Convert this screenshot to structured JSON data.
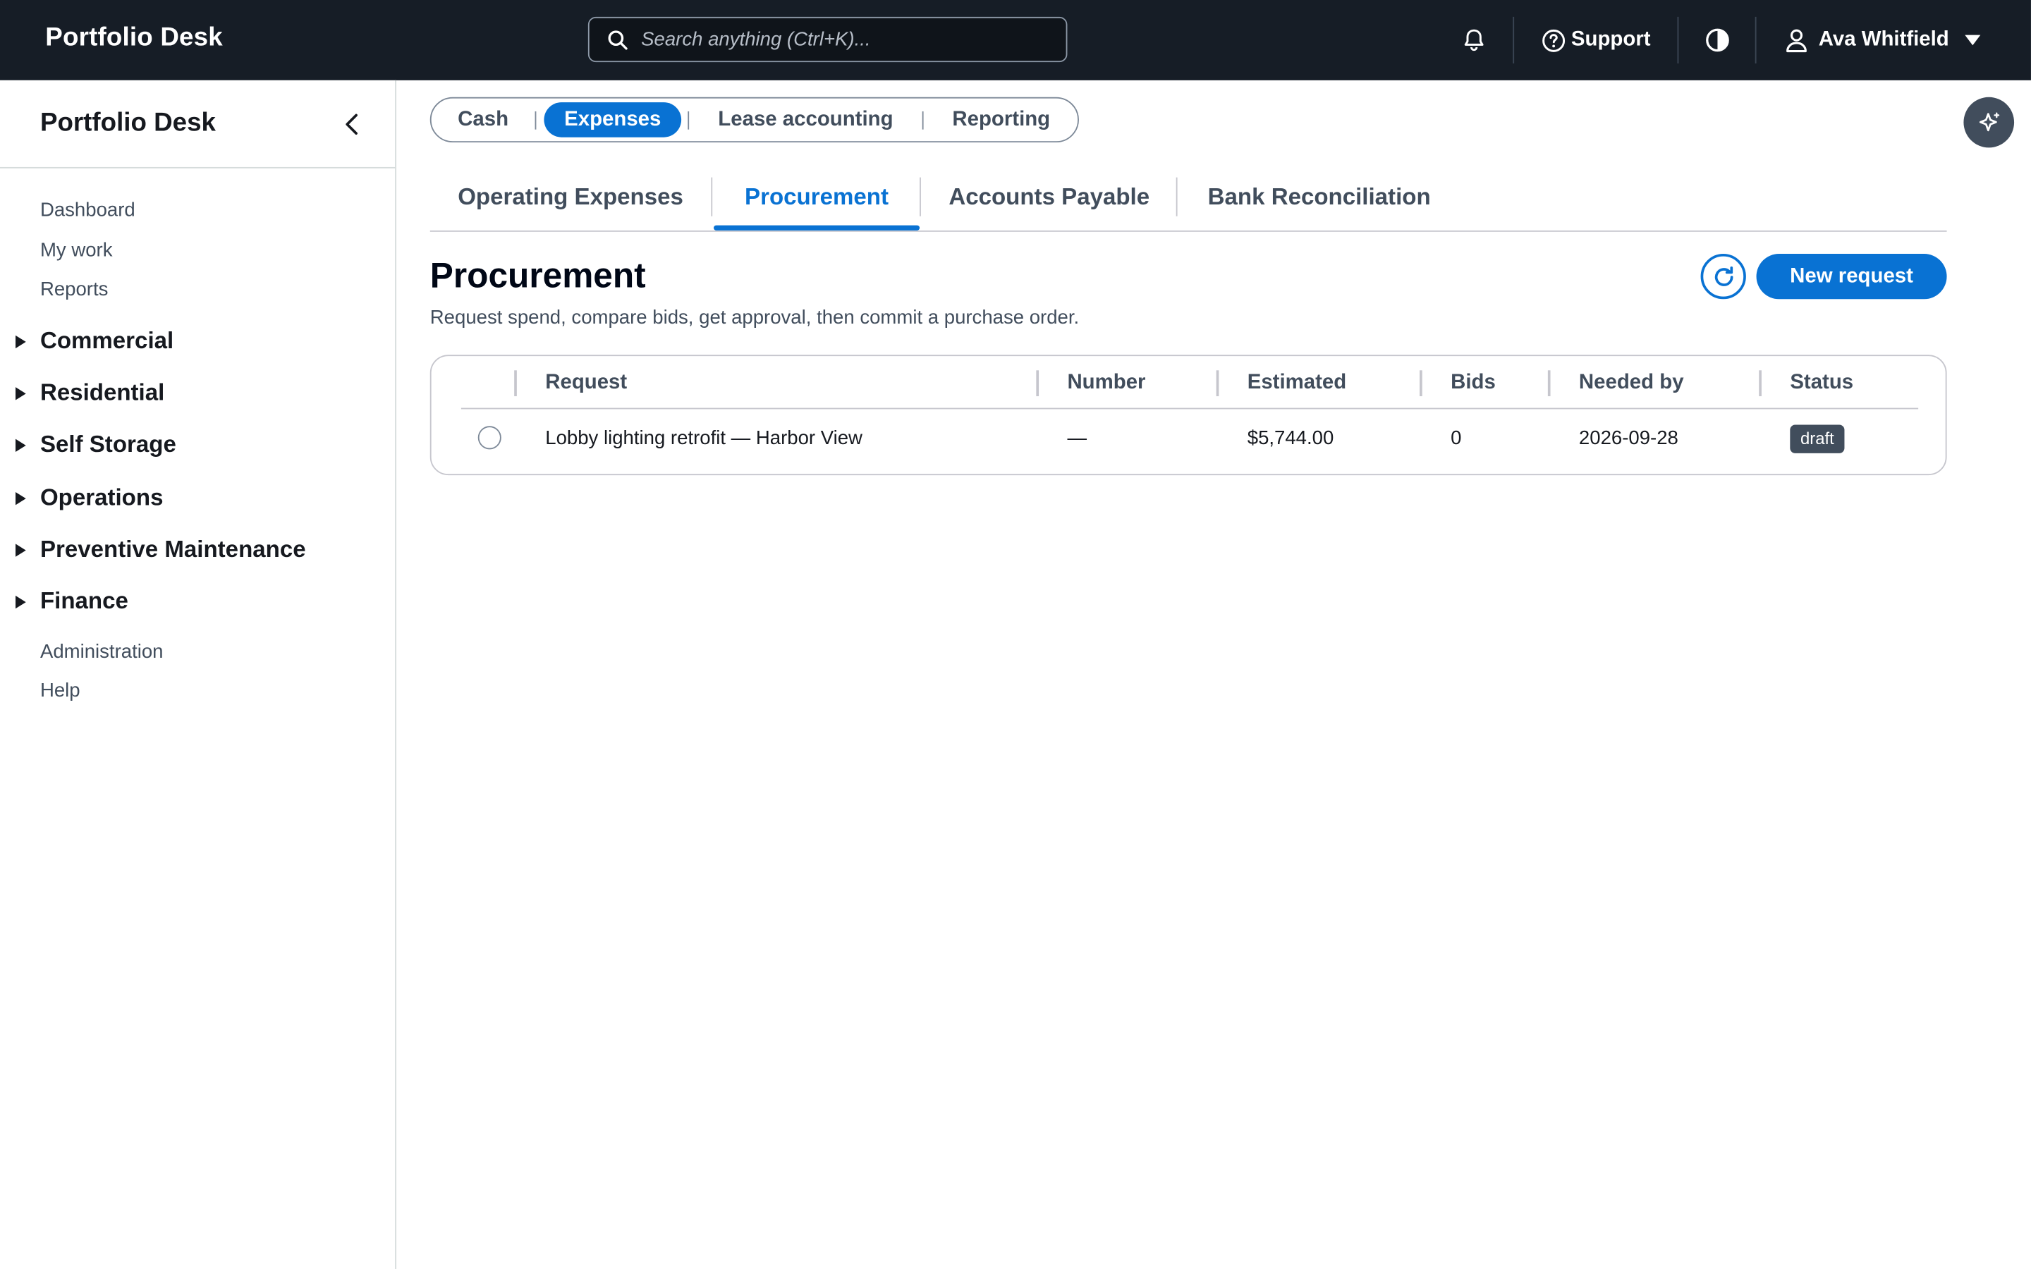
{
  "topbar": {
    "brand": "Portfolio Desk",
    "search_placeholder": "Search anything (Ctrl+K)...",
    "support_label": "Support",
    "user_name": "Ava Whitfield"
  },
  "sidebar": {
    "title": "Portfolio Desk",
    "top_links": [
      "Dashboard",
      "My work",
      "Reports"
    ],
    "sections": [
      "Commercial",
      "Residential",
      "Self Storage",
      "Operations",
      "Preventive Maintenance",
      "Finance"
    ],
    "bottom_links": [
      "Administration",
      "Help"
    ]
  },
  "segments": {
    "items": [
      "Cash",
      "Expenses",
      "Lease accounting",
      "Reporting"
    ],
    "active": "Expenses"
  },
  "tabs": {
    "items": [
      "Operating Expenses",
      "Procurement",
      "Accounts Payable",
      "Bank Reconciliation"
    ],
    "active": "Procurement"
  },
  "page": {
    "title": "Procurement",
    "description": "Request spend, compare bids, get approval, then commit a purchase order.",
    "new_button": "New request"
  },
  "table": {
    "columns": [
      "Request",
      "Number",
      "Estimated",
      "Bids",
      "Needed by",
      "Status"
    ],
    "rows": [
      {
        "request": "Lobby lighting retrofit — Harbor View",
        "number": "—",
        "estimated": "$5,744.00",
        "bids": "0",
        "needed_by": "2026-09-28",
        "status": "draft"
      }
    ]
  },
  "colors": {
    "topbar_bg": "#161d26",
    "accent": "#0972d3",
    "status_badge": "#414d5c"
  }
}
